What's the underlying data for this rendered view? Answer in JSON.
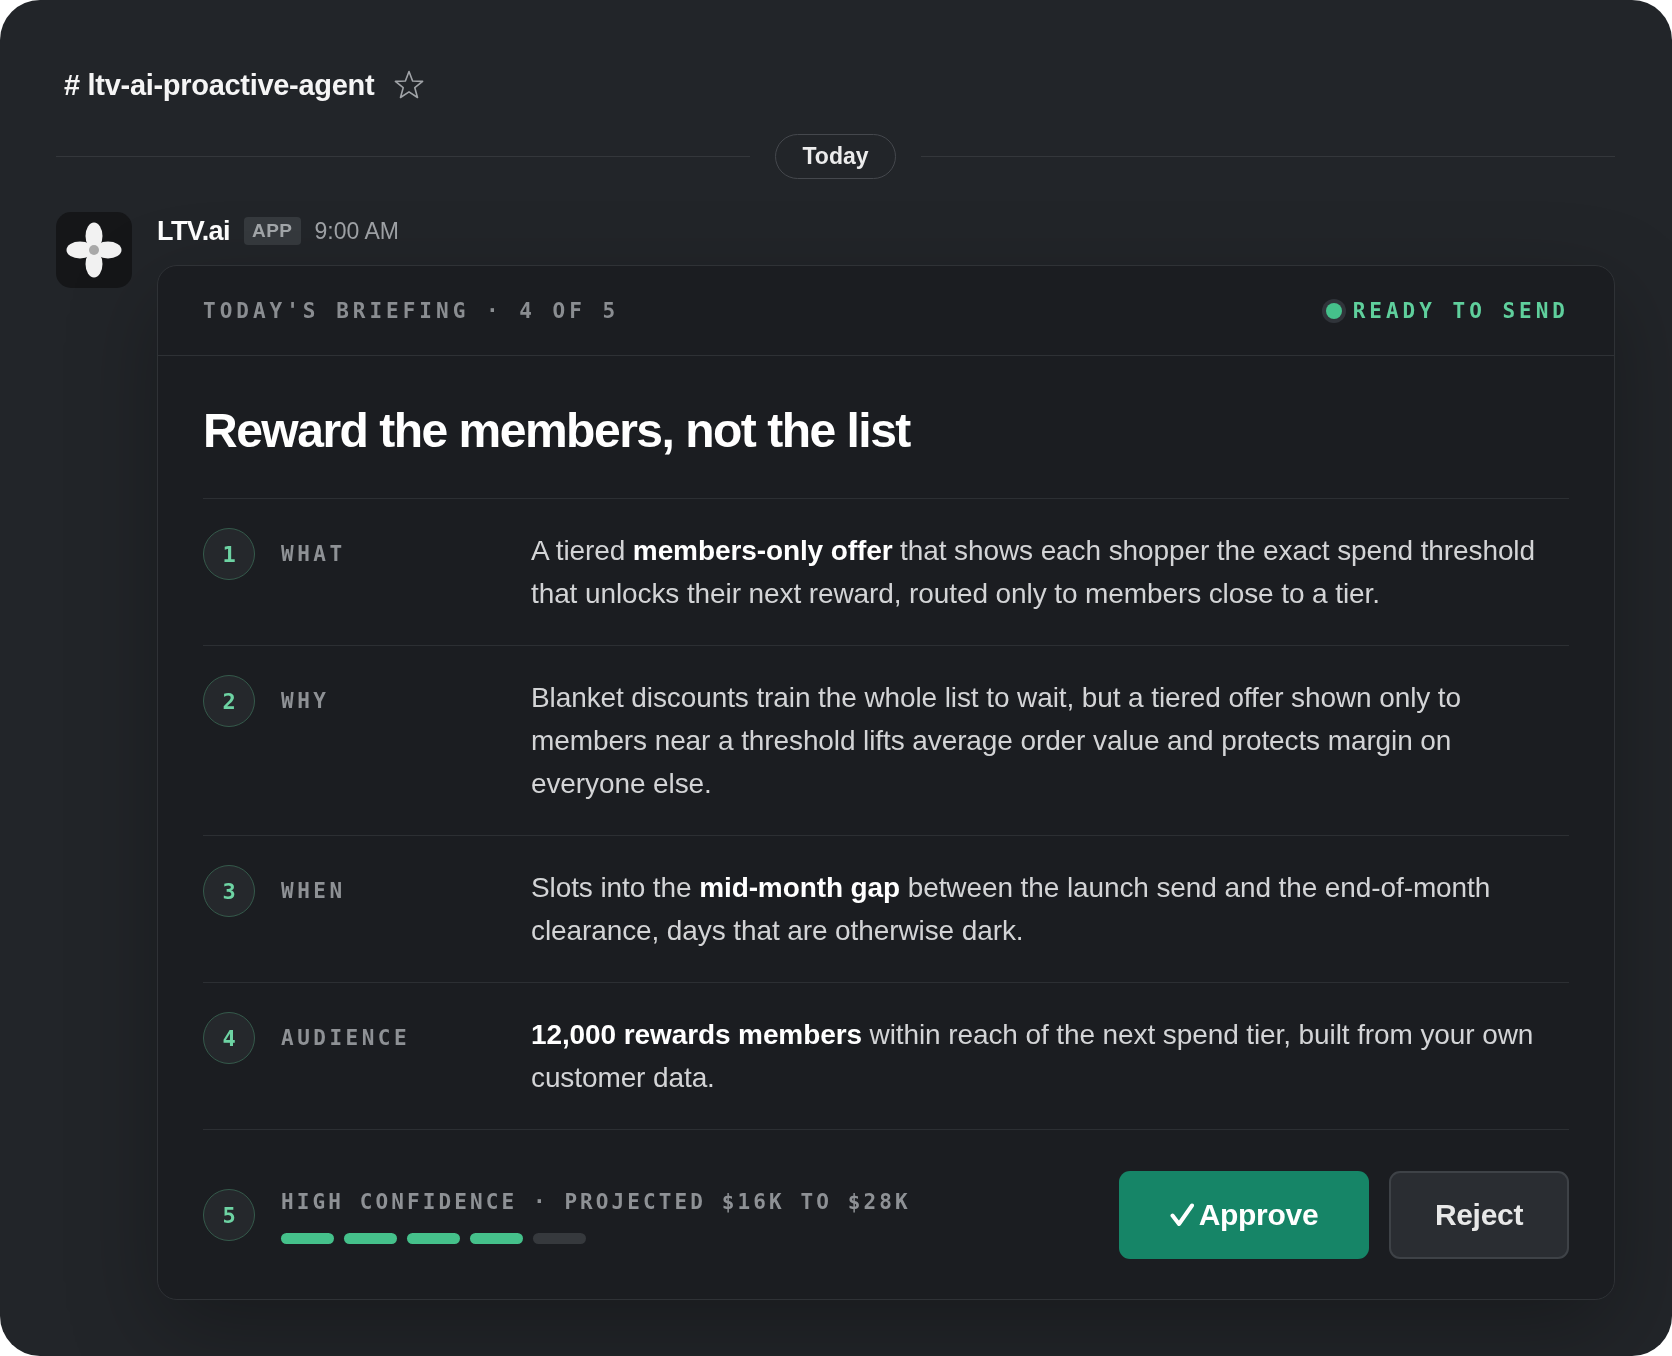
{
  "channel": {
    "name": "# ltv-ai-proactive-agent",
    "starred": false
  },
  "date_divider": {
    "label": "Today"
  },
  "message": {
    "sender": "LTV.ai",
    "badge": "APP",
    "time": "9:00 AM",
    "card": {
      "eyebrow": "TODAY'S BRIEFING · 4 OF 5",
      "status": "READY TO SEND",
      "title": "Reward the members, not the list",
      "items": [
        {
          "number": "1",
          "label": "WHAT",
          "text": "A tiered **members-only offer** that shows each shopper the exact spend threshold that unlocks their next reward, routed only to members close to a tier."
        },
        {
          "number": "2",
          "label": "WHY",
          "text": "Blanket discounts train the whole list to wait, but a tiered offer shown only to members near a threshold lifts average order value and protects margin on everyone else."
        },
        {
          "number": "3",
          "label": "WHEN",
          "text": "Slots into the **mid-month gap** between the launch send and the end-of-month clearance, days that are otherwise dark."
        },
        {
          "number": "4",
          "label": "AUDIENCE",
          "text": "**12,000 rewards members** within reach of the next spend tier, built from your own customer data."
        }
      ],
      "confidence": {
        "number": "5",
        "label": "HIGH CONFIDENCE · PROJECTED $16K TO $28K",
        "segments": [
          {
            "filled": true
          },
          {
            "filled": true
          },
          {
            "filled": true
          },
          {
            "filled": true
          },
          {
            "filled": false
          }
        ]
      },
      "actions": [
        {
          "label": "Approve",
          "kind": "approve"
        },
        {
          "label": "Reject",
          "kind": "reject"
        }
      ]
    }
  }
}
